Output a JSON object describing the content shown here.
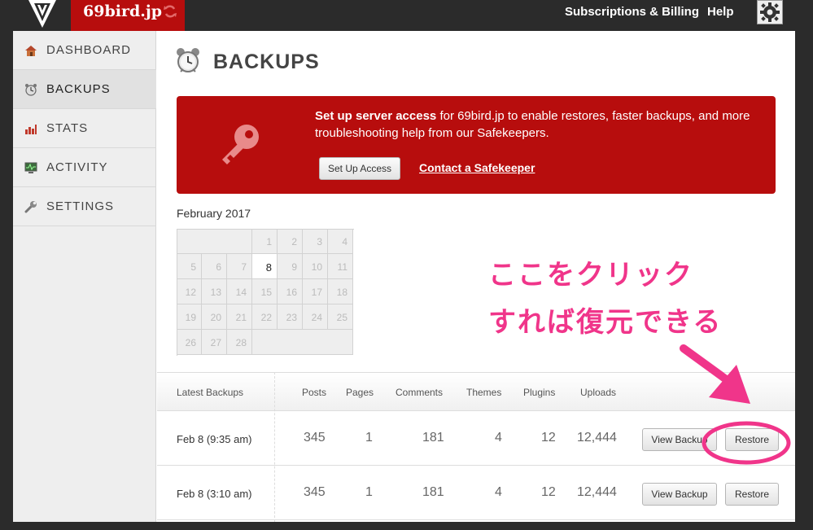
{
  "topbar": {
    "site_name": "69bird.jp",
    "nav": {
      "subscriptions": "Subscriptions & Billing",
      "help": "Help"
    }
  },
  "sidebar": {
    "items": [
      {
        "label": "DASHBOARD",
        "icon": "home-icon"
      },
      {
        "label": "BACKUPS",
        "icon": "alarm-clock-icon",
        "active": true
      },
      {
        "label": "STATS",
        "icon": "bar-chart-icon"
      },
      {
        "label": "ACTIVITY",
        "icon": "monitor-icon"
      },
      {
        "label": "SETTINGS",
        "icon": "wrench-icon"
      }
    ]
  },
  "page": {
    "title": "BACKUPS"
  },
  "alert": {
    "bold": "Set up server access",
    "text": " for 69bird.jp to enable restores, faster backups, and more troubleshooting help from our Safekeepers.",
    "button": "Set Up Access",
    "link": "Contact a Safekeeper",
    "color": "#b70d0d"
  },
  "calendar": {
    "month": "February 2017",
    "weeks": [
      [
        "",
        "",
        "",
        "1",
        "2",
        "3",
        "4"
      ],
      [
        "5",
        "6",
        "7",
        "8",
        "9",
        "10",
        "11"
      ],
      [
        "12",
        "13",
        "14",
        "15",
        "16",
        "17",
        "18"
      ],
      [
        "19",
        "20",
        "21",
        "22",
        "23",
        "24",
        "25"
      ],
      [
        "26",
        "27",
        "28",
        "",
        "",
        "",
        ""
      ]
    ],
    "selected": "8"
  },
  "table": {
    "headers": [
      "Latest Backups",
      "Posts",
      "Pages",
      "Comments",
      "Themes",
      "Plugins",
      "Uploads"
    ],
    "rows": [
      {
        "date": "Feb 8 (9:35 am)",
        "posts": "345",
        "pages": "1",
        "comments": "181",
        "themes": "4",
        "plugins": "12",
        "uploads": "12,444"
      },
      {
        "date": "Feb 8 (3:10 am)",
        "posts": "345",
        "pages": "1",
        "comments": "181",
        "themes": "4",
        "plugins": "12",
        "uploads": "12,444"
      }
    ],
    "view_label": "View Backup",
    "restore_label": "Restore"
  },
  "annotation": {
    "line1": "ここをクリック",
    "line2": "すれば復元できる",
    "color": "#f0358a"
  }
}
